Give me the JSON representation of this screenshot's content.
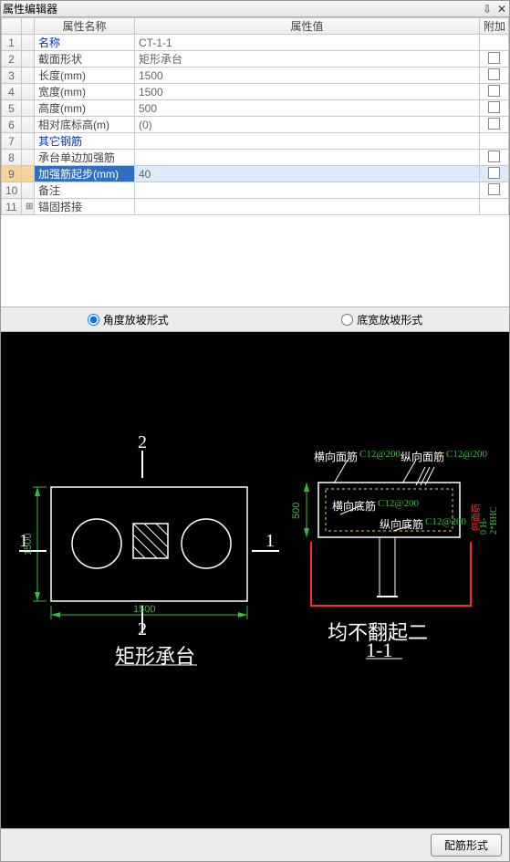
{
  "window": {
    "title": "属性编辑器"
  },
  "table": {
    "headers": {
      "name": "属性名称",
      "value": "属性值",
      "add": "附加"
    },
    "rows": [
      {
        "num": "1",
        "exp": "",
        "name": "名称",
        "val": "CT-1-1",
        "blue": true,
        "chk": false,
        "selected": false
      },
      {
        "num": "2",
        "exp": "",
        "name": "截面形状",
        "val": "矩形承台",
        "blue": false,
        "chk": true,
        "selected": false
      },
      {
        "num": "3",
        "exp": "",
        "name": "长度(mm)",
        "val": "1500",
        "blue": false,
        "chk": true,
        "selected": false
      },
      {
        "num": "4",
        "exp": "",
        "name": "宽度(mm)",
        "val": "1500",
        "blue": false,
        "chk": true,
        "selected": false
      },
      {
        "num": "5",
        "exp": "",
        "name": "高度(mm)",
        "val": "500",
        "blue": false,
        "chk": true,
        "selected": false
      },
      {
        "num": "6",
        "exp": "",
        "name": "相对底标高(m)",
        "val": "(0)",
        "blue": false,
        "chk": true,
        "selected": false
      },
      {
        "num": "7",
        "exp": "",
        "name": "其它钢筋",
        "val": "",
        "blue": true,
        "chk": false,
        "selected": false
      },
      {
        "num": "8",
        "exp": "",
        "name": "承台单边加强筋",
        "val": "",
        "blue": false,
        "chk": true,
        "selected": false
      },
      {
        "num": "9",
        "exp": "",
        "name": "加强筋起步(mm)",
        "val": "40",
        "blue": false,
        "chk": true,
        "selected": true
      },
      {
        "num": "10",
        "exp": "",
        "name": "备注",
        "val": "",
        "blue": false,
        "chk": true,
        "selected": false
      },
      {
        "num": "11",
        "exp": "+",
        "name": "锚固搭接",
        "val": "",
        "blue": false,
        "chk": false,
        "selected": false
      }
    ]
  },
  "radios": {
    "opt1": "角度放坡形式",
    "opt2": "底宽放坡形式",
    "selected": 1
  },
  "diagram": {
    "left": {
      "title": "矩形承台",
      "dim_h": "1500",
      "dim_v": "1500",
      "mark1": "1",
      "mark2": "2"
    },
    "right": {
      "title1": "均不翻起二",
      "title2": "1-1",
      "dim_v": "500",
      "lbl_top_l": "横向面筋",
      "lbl_top_l_v": "C12@200",
      "lbl_top_r": "纵向面筋",
      "lbl_top_r_v": "C12@200",
      "lbl_mid": "横向底筋",
      "lbl_mid_v": "C12@200",
      "lbl_bot": "纵向底筋",
      "lbl_bot_v": "C12@200",
      "side_lbl": "侧面筋",
      "side_v": "0  H-2*BHC"
    }
  },
  "bottom": {
    "btn": "配筋形式"
  }
}
